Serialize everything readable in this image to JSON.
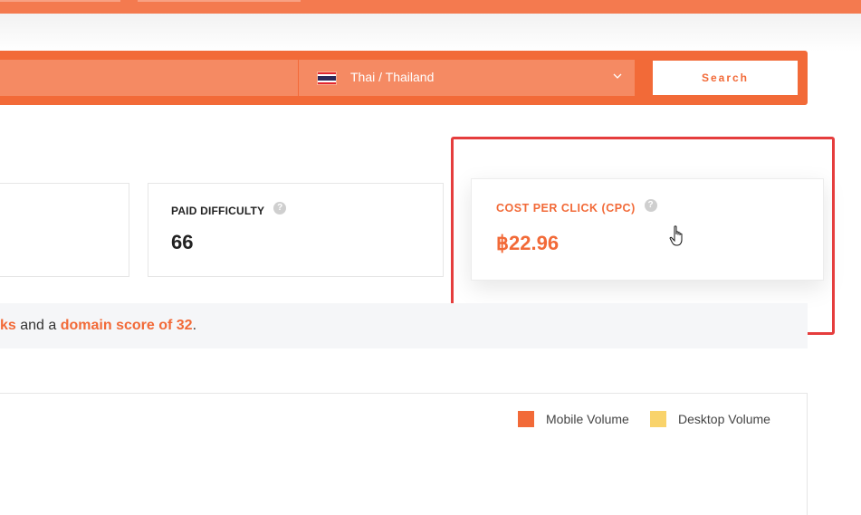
{
  "search": {
    "language_label": "Thai / Thailand",
    "search_button": "Search"
  },
  "metrics": {
    "paid_difficulty": {
      "title": "PAID DIFFICULTY",
      "value": "66",
      "help": "?"
    },
    "cpc": {
      "title": "COST PER CLICK (CPC)",
      "value": "฿22.96",
      "help": "?"
    }
  },
  "summary": {
    "partial_link": "ks",
    "text_mid": " and a ",
    "domain_score_link": "domain score of 32",
    "text_end": "."
  },
  "chart": {
    "legend": [
      {
        "label": "Mobile Volume",
        "color": "#f26a38"
      },
      {
        "label": "Desktop Volume",
        "color": "#f9d36b"
      }
    ]
  },
  "colors": {
    "brand": "#f26a38",
    "highlight": "#e53d3d"
  }
}
